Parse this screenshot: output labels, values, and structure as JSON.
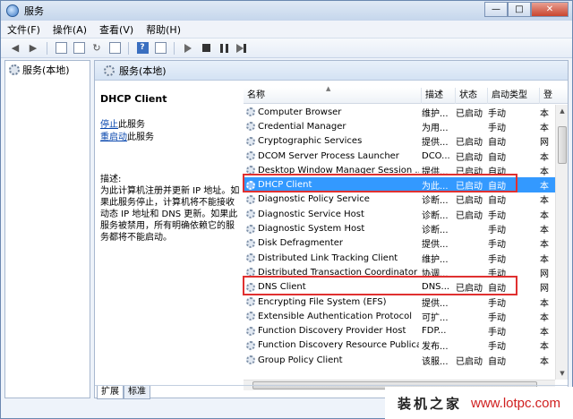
{
  "window": {
    "title": "服务",
    "btn_min": "—",
    "btn_max": "□",
    "btn_close": "✕"
  },
  "menu": [
    "文件(F)",
    "操作(A)",
    "查看(V)",
    "帮助(H)"
  ],
  "tree": {
    "item": "服务(本地)"
  },
  "header": {
    "title": "服务(本地)"
  },
  "detail": {
    "service_name": "DHCP Client",
    "stop_link": "停止",
    "stop_suffix": "此服务",
    "restart_link": "重启动",
    "restart_suffix": "此服务",
    "desc_label": "描述:",
    "description": "为此计算机注册并更新 IP 地址。如果此服务停止，计算机将不能接收动态 IP 地址和 DNS 更新。如果此服务被禁用，所有明确依赖它的服务都将不能启动。"
  },
  "columns": {
    "name": "名称",
    "desc": "描述",
    "status": "状态",
    "startup": "启动类型",
    "logon": "登"
  },
  "rows": [
    {
      "name": "Computer Browser",
      "desc": "维护...",
      "status": "已启动",
      "startup": "手动",
      "logon": "本"
    },
    {
      "name": "Credential Manager",
      "desc": "为用...",
      "status": "",
      "startup": "手动",
      "logon": "本"
    },
    {
      "name": "Cryptographic Services",
      "desc": "提供...",
      "status": "已启动",
      "startup": "自动",
      "logon": "网"
    },
    {
      "name": "DCOM Server Process Launcher",
      "desc": "DCO...",
      "status": "已启动",
      "startup": "自动",
      "logon": "本"
    },
    {
      "name": "Desktop Window Manager Session ...",
      "desc": "提供...",
      "status": "已启动",
      "startup": "自动",
      "logon": "本"
    },
    {
      "name": "DHCP Client",
      "desc": "为此...",
      "status": "已启动",
      "startup": "自动",
      "logon": "本"
    },
    {
      "name": "Diagnostic Policy Service",
      "desc": "诊断...",
      "status": "已启动",
      "startup": "自动",
      "logon": "本"
    },
    {
      "name": "Diagnostic Service Host",
      "desc": "诊断...",
      "status": "已启动",
      "startup": "手动",
      "logon": "本"
    },
    {
      "name": "Diagnostic System Host",
      "desc": "诊断...",
      "status": "",
      "startup": "手动",
      "logon": "本"
    },
    {
      "name": "Disk Defragmenter",
      "desc": "提供...",
      "status": "",
      "startup": "手动",
      "logon": "本"
    },
    {
      "name": "Distributed Link Tracking Client",
      "desc": "维护...",
      "status": "",
      "startup": "手动",
      "logon": "本"
    },
    {
      "name": "Distributed Transaction Coordinator",
      "desc": "协调...",
      "status": "",
      "startup": "手动",
      "logon": "网"
    },
    {
      "name": "DNS Client",
      "desc": "DNS...",
      "status": "已启动",
      "startup": "自动",
      "logon": "网"
    },
    {
      "name": "Encrypting File System (EFS)",
      "desc": "提供...",
      "status": "",
      "startup": "手动",
      "logon": "本"
    },
    {
      "name": "Extensible Authentication Protocol",
      "desc": "可扩...",
      "status": "",
      "startup": "手动",
      "logon": "本"
    },
    {
      "name": "Function Discovery Provider Host",
      "desc": "FDP...",
      "status": "",
      "startup": "手动",
      "logon": "本"
    },
    {
      "name": "Function Discovery Resource Publicati...",
      "desc": "发布...",
      "status": "",
      "startup": "手动",
      "logon": "本"
    },
    {
      "name": "Group Policy Client",
      "desc": "该服...",
      "status": "已启动",
      "startup": "自动",
      "logon": "本"
    }
  ],
  "tabs": [
    "扩展",
    "标准"
  ],
  "watermark": {
    "cn": "装机之家",
    "url": "www.lotpc.com"
  },
  "colors": {
    "selection": "#3399ff",
    "highlight_box": "#e03030",
    "link": "#0645ad"
  }
}
